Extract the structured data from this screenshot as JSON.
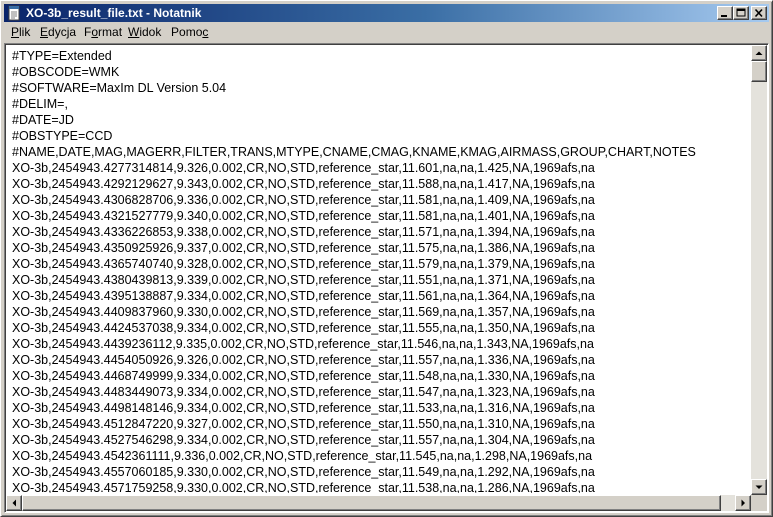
{
  "window": {
    "title": "XO-3b_result_file.txt - Notatnik"
  },
  "menu": [
    {
      "accel": "P",
      "rest": "lik"
    },
    {
      "accel": "E",
      "rest": "dycja"
    },
    {
      "accel": "F",
      "rest": "ormat",
      "prefix": ""
    },
    {
      "accel": "W",
      "rest": "idok"
    },
    {
      "accel": "P",
      "rest": "omoc"
    }
  ],
  "menu_labels": [
    "Plik",
    "Edycja",
    "Format",
    "Widok",
    "Pomoc"
  ],
  "document": {
    "lines": [
      "#TYPE=Extended",
      "#OBSCODE=WMK",
      "#SOFTWARE=MaxIm DL Version 5.04",
      "#DELIM=,",
      "#DATE=JD",
      "#OBSTYPE=CCD",
      "#NAME,DATE,MAG,MAGERR,FILTER,TRANS,MTYPE,CNAME,CMAG,KNAME,KMAG,AIRMASS,GROUP,CHART,NOTES",
      "XO-3b,2454943.4277314814,9.326,0.002,CR,NO,STD,reference_star,11.601,na,na,1.425,NA,1969afs,na",
      "XO-3b,2454943.4292129627,9.343,0.002,CR,NO,STD,reference_star,11.588,na,na,1.417,NA,1969afs,na",
      "XO-3b,2454943.4306828706,9.336,0.002,CR,NO,STD,reference_star,11.581,na,na,1.409,NA,1969afs,na",
      "XO-3b,2454943.4321527779,9.340,0.002,CR,NO,STD,reference_star,11.581,na,na,1.401,NA,1969afs,na",
      "XO-3b,2454943.4336226853,9.338,0.002,CR,NO,STD,reference_star,11.571,na,na,1.394,NA,1969afs,na",
      "XO-3b,2454943.4350925926,9.337,0.002,CR,NO,STD,reference_star,11.575,na,na,1.386,NA,1969afs,na",
      "XO-3b,2454943.4365740740,9.328,0.002,CR,NO,STD,reference_star,11.579,na,na,1.379,NA,1969afs,na",
      "XO-3b,2454943.4380439813,9.339,0.002,CR,NO,STD,reference_star,11.551,na,na,1.371,NA,1969afs,na",
      "XO-3b,2454943.4395138887,9.334,0.002,CR,NO,STD,reference_star,11.561,na,na,1.364,NA,1969afs,na",
      "XO-3b,2454943.4409837960,9.330,0.002,CR,NO,STD,reference_star,11.569,na,na,1.357,NA,1969afs,na",
      "XO-3b,2454943.4424537038,9.334,0.002,CR,NO,STD,reference_star,11.555,na,na,1.350,NA,1969afs,na",
      "XO-3b,2454943.4439236112,9.335,0.002,CR,NO,STD,reference_star,11.546,na,na,1.343,NA,1969afs,na",
      "XO-3b,2454943.4454050926,9.326,0.002,CR,NO,STD,reference_star,11.557,na,na,1.336,NA,1969afs,na",
      "XO-3b,2454943.4468749999,9.334,0.002,CR,NO,STD,reference_star,11.548,na,na,1.330,NA,1969afs,na",
      "XO-3b,2454943.4483449073,9.334,0.002,CR,NO,STD,reference_star,11.547,na,na,1.323,NA,1969afs,na",
      "XO-3b,2454943.4498148146,9.334,0.002,CR,NO,STD,reference_star,11.533,na,na,1.316,NA,1969afs,na",
      "XO-3b,2454943.4512847220,9.327,0.002,CR,NO,STD,reference_star,11.550,na,na,1.310,NA,1969afs,na",
      "XO-3b,2454943.4527546298,9.334,0.002,CR,NO,STD,reference_star,11.557,na,na,1.304,NA,1969afs,na",
      "XO-3b,2454943.4542361111,9.336,0.002,CR,NO,STD,reference_star,11.545,na,na,1.298,NA,1969afs,na",
      "XO-3b,2454943.4557060185,9.330,0.002,CR,NO,STD,reference_star,11.549,na,na,1.292,NA,1969afs,na",
      "XO-3b,2454943.4571759258,9.330,0.002,CR,NO,STD,reference_star,11.538,na,na,1.286,NA,1969afs,na"
    ]
  },
  "icons": {
    "app": "notepad-icon",
    "minimize": "minimize-icon",
    "maximize": "maximize-icon",
    "close": "close-icon",
    "scroll_up": "arrow-up-icon",
    "scroll_down": "arrow-down-icon",
    "scroll_left": "arrow-left-icon",
    "scroll_right": "arrow-right-icon"
  },
  "colors": {
    "titlebar_start": "#0a246a",
    "titlebar_end": "#a6caf0",
    "face": "#d4d0c8",
    "editor_bg": "#ffffff"
  },
  "scroll": {
    "vertical_thumb_fraction": 0.05,
    "horizontal_thumb_fraction": 0.98
  }
}
